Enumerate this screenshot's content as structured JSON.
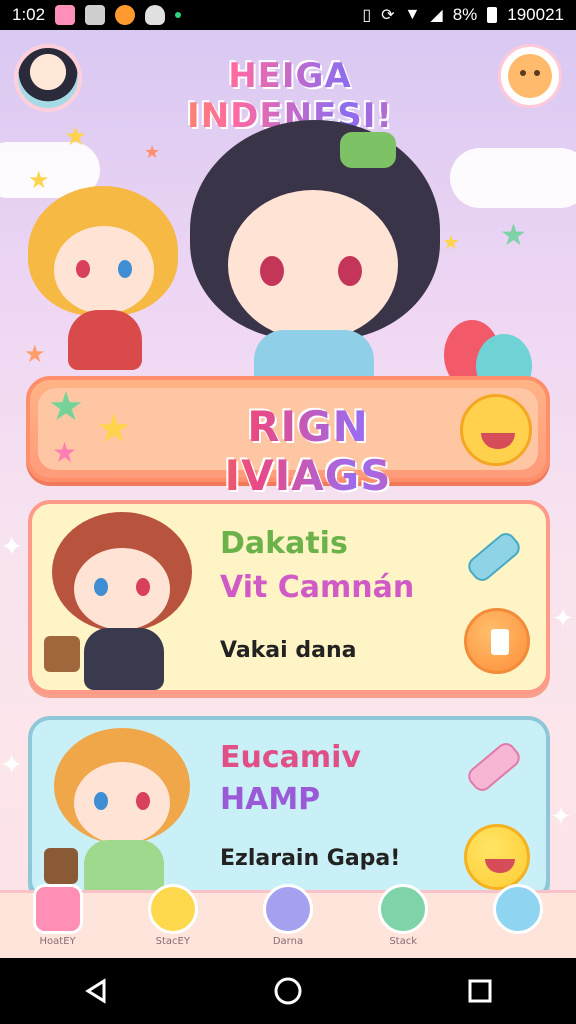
{
  "status_bar": {
    "time": "1:02",
    "battery": "8%",
    "clock_right": "190021"
  },
  "header": {
    "title": "HEIGA INDENESI!"
  },
  "banner": {
    "label": "RIGN IVIAGS"
  },
  "cards": [
    {
      "title": "Dakatis",
      "subtitle": "Vit Camnán",
      "description": "Vakai dana",
      "title_color": "#6bb24a",
      "subtitle_color": "#d05bc6"
    },
    {
      "title": "Eucamiv",
      "subtitle": "HAMP",
      "description": "Ezlarain Gapa!",
      "title_color": "#e04f86",
      "subtitle_color": "#9a5ad8"
    }
  ],
  "bottom_nav": [
    {
      "label": "HoatEY",
      "icon": "house-icon"
    },
    {
      "label": "StacEY",
      "icon": "chick-icon"
    },
    {
      "label": "Darna",
      "icon": "heart-icon"
    },
    {
      "label": "Stack",
      "icon": "frog-icon"
    },
    {
      "label": "",
      "icon": "smile-icon"
    }
  ],
  "colors": {
    "accent_orange": "#ff9b7a",
    "card_yellow": "#fff4c6",
    "card_blue": "#c9f0f6"
  }
}
